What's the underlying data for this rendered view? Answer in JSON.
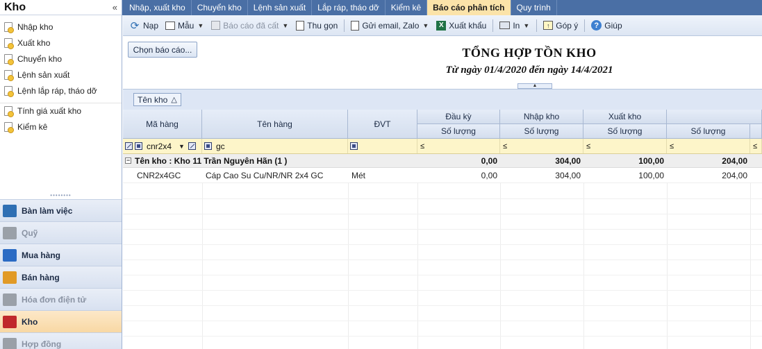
{
  "sidebar": {
    "title": "Kho",
    "collapse_glyph": "«",
    "items": [
      {
        "label": "Nhập kho"
      },
      {
        "label": "Xuất kho"
      },
      {
        "label": "Chuyển kho"
      },
      {
        "label": "Lệnh sản xuất"
      },
      {
        "label": "Lệnh lắp ráp, tháo dỡ"
      },
      {
        "label": "Tính giá xuất kho"
      },
      {
        "label": "Kiểm kê"
      }
    ],
    "modules": [
      {
        "label": "Bàn làm việc",
        "state": "normal",
        "color": "#2f6fb3"
      },
      {
        "label": "Quỹ",
        "state": "disabled",
        "color": "#9aa0a8"
      },
      {
        "label": "Mua hàng",
        "state": "normal",
        "color": "#2b6bc4"
      },
      {
        "label": "Bán hàng",
        "state": "normal",
        "color": "#e19a26"
      },
      {
        "label": "Hóa đơn điện tử",
        "state": "disabled",
        "color": "#9aa0a8"
      },
      {
        "label": "Kho",
        "state": "active",
        "color": "#c0282b"
      },
      {
        "label": "Hợp đồng",
        "state": "disabled",
        "color": "#9aa0a8"
      }
    ]
  },
  "tabs": [
    {
      "label": "Nhập, xuất kho"
    },
    {
      "label": "Chuyển kho"
    },
    {
      "label": "Lệnh sản xuất"
    },
    {
      "label": "Lắp ráp, tháo dỡ"
    },
    {
      "label": "Kiểm kê"
    },
    {
      "label": "Báo cáo phân tích",
      "active": true
    },
    {
      "label": "Quy trình"
    }
  ],
  "toolbar": {
    "refresh": "Nạp",
    "template": "Mẫu",
    "saved_reports": "Báo cáo đã cất",
    "collapse": "Thu gọn",
    "send": "Gửi email, Zalo",
    "export": "Xuất khẩu",
    "print": "In",
    "feedback": "Góp ý",
    "help": "Giúp"
  },
  "report": {
    "choose_label": "Chọn báo cáo...",
    "title": "TỔNG HỢP TỒN KHO",
    "subtitle": "Từ ngày 01/4/2020 đến ngày 14/4/2021"
  },
  "group_chip": {
    "label": "Tên kho",
    "sort_glyph": "△"
  },
  "grid": {
    "headers": {
      "code": "Mã hàng",
      "name": "Tên hàng",
      "unit": "ĐVT",
      "opening": "Đầu kỳ",
      "inbound": "Nhập kho",
      "outbound": "Xuất kho",
      "qty": "Số lượng"
    },
    "filter": {
      "code_value": "cnr2x4",
      "name_value": "gc",
      "op": "≤"
    },
    "group": {
      "label": "Tên kho : Kho 11 Trần Nguyên Hãn (1 )",
      "opening": "0,00",
      "inbound": "304,00",
      "outbound": "100,00",
      "closing": "204,00"
    },
    "rows": [
      {
        "code": "CNR2x4GC",
        "name": "Cáp Cao Su Cu/NR/NR 2x4 GC",
        "unit": "Mét",
        "opening": "0,00",
        "inbound": "304,00",
        "outbound": "100,00",
        "closing": "204,00"
      }
    ]
  }
}
